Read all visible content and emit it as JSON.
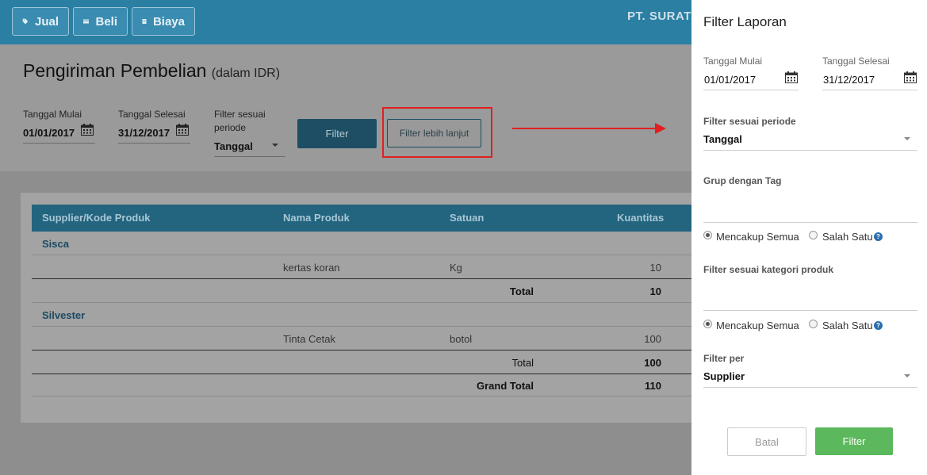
{
  "header": {
    "nav": [
      {
        "label": "Jual",
        "icon": "tag-icon"
      },
      {
        "label": "Beli",
        "icon": "card-icon"
      },
      {
        "label": "Biaya",
        "icon": "receipt-icon"
      }
    ],
    "company": "PT. SURAT"
  },
  "page": {
    "title": "Pengiriman Pembelian",
    "currency_note": "(dalam IDR)"
  },
  "filters": {
    "start_label": "Tanggal Mulai",
    "start_value": "01/01/2017",
    "end_label": "Tanggal Selesai",
    "end_value": "31/12/2017",
    "period_label_1": "Filter sesuai",
    "period_label_2": "periode",
    "period_value": "Tanggal",
    "filter_button": "Filter",
    "advanced_button": "Filter lebih lanjut"
  },
  "table": {
    "columns": [
      "Supplier/Kode Produk",
      "Nama Produk",
      "Satuan",
      "Kuantitas"
    ],
    "groups": [
      {
        "name": "Sisca",
        "items": [
          {
            "product": "kertas koran",
            "unit": "Kg",
            "qty": "10"
          }
        ],
        "total_label": "Total",
        "total": "10"
      },
      {
        "name": "Silvester",
        "items": [
          {
            "product": "Tinta Cetak",
            "unit": "botol",
            "qty": "100"
          }
        ],
        "total_label": "Total",
        "total": "100"
      }
    ],
    "grand_total_label": "Grand Total",
    "grand_total": "110"
  },
  "panel": {
    "title": "Filter Laporan",
    "start_label": "Tanggal Mulai",
    "start_value": "01/01/2017",
    "end_label": "Tanggal Selesai",
    "end_value": "31/12/2017",
    "period_label": "Filter sesuai periode",
    "period_value": "Tanggal",
    "tag_label": "Grup dengan Tag",
    "tag_value": "",
    "radio_all": "Mencakup Semua",
    "radio_any": "Salah Satu",
    "category_label": "Filter sesuai kategori produk",
    "category_value": "",
    "radio_all_2": "Mencakup Semua",
    "radio_any_2": "Salah Satu",
    "filter_per_label": "Filter per",
    "filter_per_value": "Supplier",
    "cancel_button": "Batal",
    "apply_button": "Filter"
  },
  "colors": {
    "header": "#2a7fa3",
    "table_header": "#23647f",
    "apply": "#5cb85c",
    "annotation": "#e02020"
  }
}
